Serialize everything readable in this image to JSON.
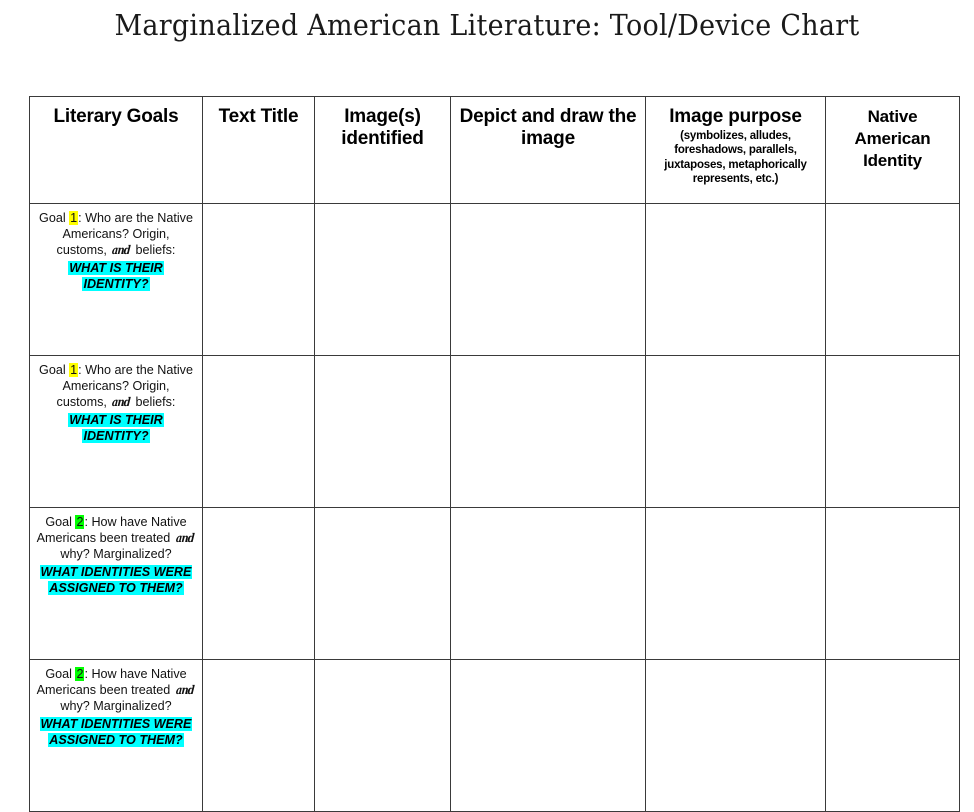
{
  "document": {
    "title": "Marginalized American Literature: Tool/Device Chart"
  },
  "colors": {
    "highlight_goal_one": "#ffff00",
    "highlight_goal_two": "#00ff00",
    "highlight_question": "#00ffff",
    "border": "#3a3a3a",
    "text": "#000000",
    "background": "#ffffff"
  },
  "table": {
    "headers": [
      {
        "main": "Literary Goals",
        "sub": ""
      },
      {
        "main": "Text Title",
        "sub": ""
      },
      {
        "main": "Image(s) identified",
        "sub": ""
      },
      {
        "main": "Depict and draw the image",
        "sub": ""
      },
      {
        "main": "Image purpose",
        "sub": "(symbolizes, alludes, foreshadows, parallels, juxtaposes, metaphorically represents, etc.)"
      },
      {
        "main": "Native American Identity",
        "sub": ""
      }
    ],
    "rows": [
      {
        "goal_label": "Goal",
        "goal_number": "1",
        "goal_number_highlight": "yellow",
        "goal_text_before_and": ": Who are the Native Americans? Origin, customs,",
        "and_word": "and",
        "goal_text_after_and": "beliefs:",
        "question": "WHAT IS THEIR IDENTITY?",
        "text_title": "",
        "images_identified": "",
        "depict_and_draw": "",
        "image_purpose": "",
        "native_american_identity": ""
      },
      {
        "goal_label": "Goal",
        "goal_number": "1",
        "goal_number_highlight": "yellow",
        "goal_text_before_and": ": Who are the Native Americans? Origin, customs,",
        "and_word": "and",
        "goal_text_after_and": "beliefs:",
        "question": "WHAT IS THEIR IDENTITY?",
        "text_title": "",
        "images_identified": "",
        "depict_and_draw": "",
        "image_purpose": "",
        "native_american_identity": ""
      },
      {
        "goal_label": "Goal",
        "goal_number": "2",
        "goal_number_highlight": "green",
        "goal_text_before_and": ": How have Native Americans been treated",
        "and_word": "and",
        "goal_text_after_and": "why? Marginalized?",
        "question": "WHAT IDENTITIES WERE ASSIGNED TO THEM?",
        "text_title": "",
        "images_identified": "",
        "depict_and_draw": "",
        "image_purpose": "",
        "native_american_identity": ""
      },
      {
        "goal_label": "Goal",
        "goal_number": "2",
        "goal_number_highlight": "green",
        "goal_text_before_and": ": How have Native Americans been treated",
        "and_word": "and",
        "goal_text_after_and": "why? Marginalized?",
        "question": "WHAT IDENTITIES WERE ASSIGNED TO THEM?",
        "text_title": "",
        "images_identified": "",
        "depict_and_draw": "",
        "image_purpose": "",
        "native_american_identity": ""
      }
    ]
  }
}
